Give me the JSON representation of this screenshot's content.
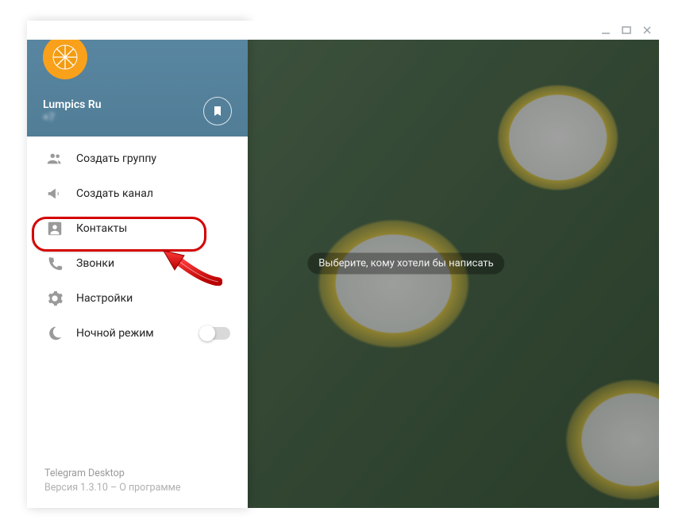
{
  "profile": {
    "name": "Lumpics Ru",
    "phone": "+7"
  },
  "menu": {
    "new_group": "Создать группу",
    "new_channel": "Создать канал",
    "contacts": "Контакты",
    "calls": "Звонки",
    "settings": "Настройки",
    "night_mode": "Ночной режим"
  },
  "footer": {
    "app_name": "Telegram Desktop",
    "version_line": "Версия 1.3.10 – О программе"
  },
  "main": {
    "hint": "Выберите, кому хотели бы написать"
  }
}
